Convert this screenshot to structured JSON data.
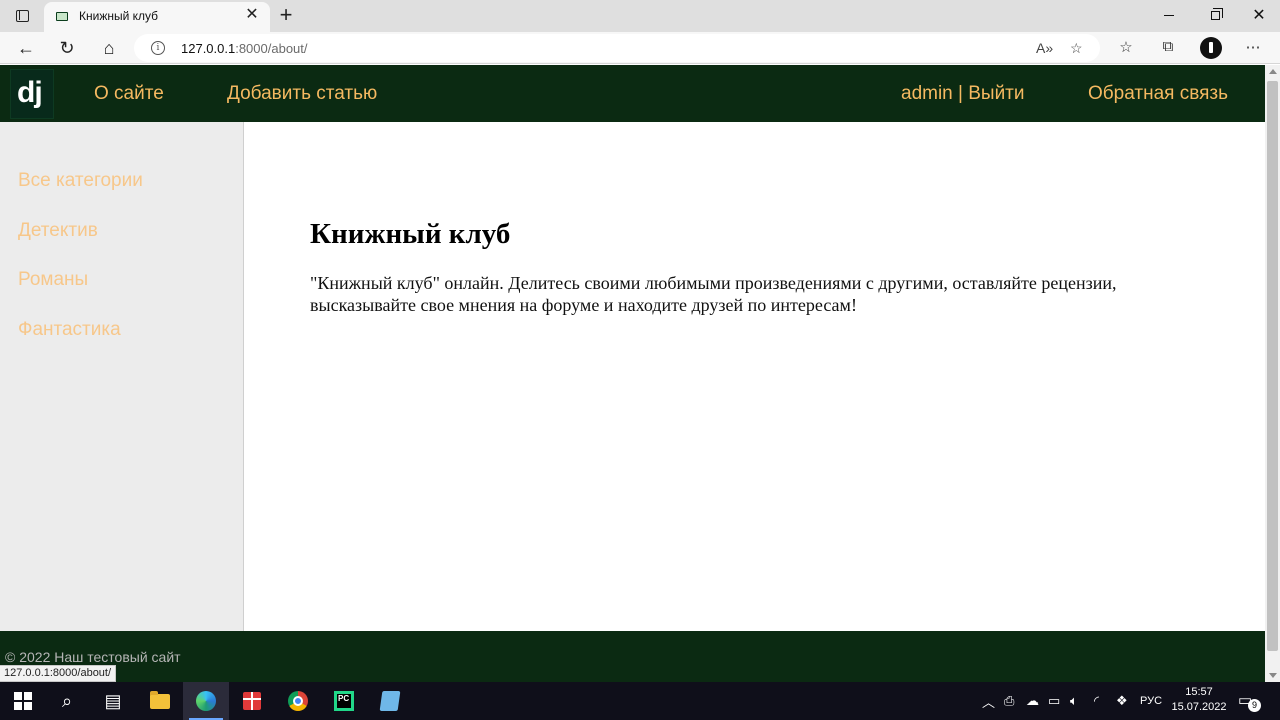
{
  "browser": {
    "tab_title": "Книжный клуб",
    "address_host": "127.0.0.1",
    "address_path": ":8000/about/",
    "status_url": "127.0.0.1:8000/about/"
  },
  "site": {
    "logo": "dj",
    "nav": {
      "about": "О сайте",
      "add_article": "Добавить статью",
      "user": "admin | Выйти",
      "feedback": "Обратная связь"
    },
    "sidebar": [
      {
        "label": "Все категории"
      },
      {
        "label": "Детектив"
      },
      {
        "label": "Романы"
      },
      {
        "label": "Фантастика"
      }
    ],
    "content": {
      "title": "Книжный клуб",
      "text": "\"Книжный клуб\" онлайн. Делитесь своими любимыми произведениями с другими, оставляйте рецензии, высказывайте свое мнения на форуме и находите друзей по интересам!"
    },
    "footer": "© 2022 Наш тестовый сайт",
    "colors": {
      "header_bg": "#0b2a12",
      "nav_link": "#f5b961",
      "sidebar_link": "#f7c78a",
      "sidebar_bg": "#ececec"
    }
  },
  "taskbar": {
    "language": "РУС",
    "time": "15:57",
    "date": "15.07.2022",
    "notification_count": "9",
    "icons": [
      "windows-start-icon",
      "search-icon",
      "task-view-icon",
      "file-explorer-icon",
      "edge-icon",
      "gift-icon",
      "chrome-icon",
      "pycharm-icon",
      "notepad-icon"
    ]
  }
}
